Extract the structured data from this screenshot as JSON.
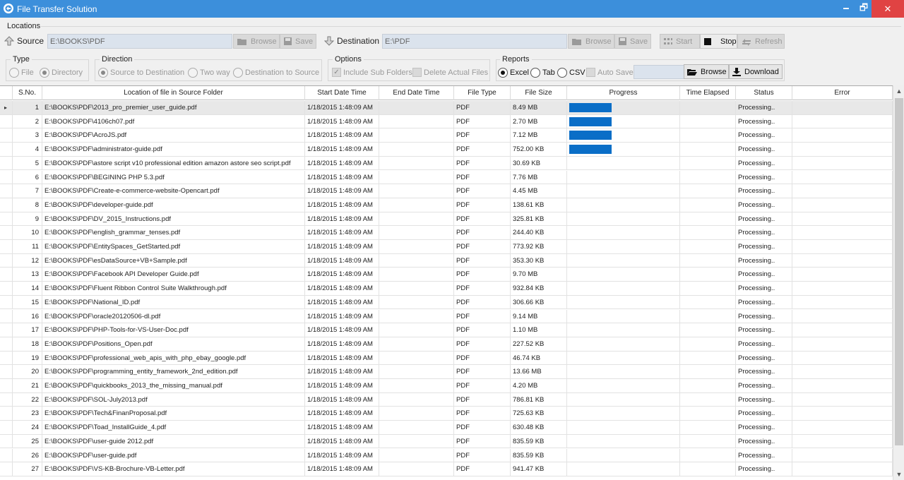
{
  "window": {
    "title": "File Transfer Solution",
    "minimize": "🗕",
    "maximize": "🗗",
    "close": "✕"
  },
  "locations": {
    "label": "Locations",
    "source_label": "Source",
    "source_path": "E:\\BOOKS\\PDF",
    "source_browse": "Browse",
    "source_save": "Save",
    "destination_label": "Destination",
    "destination_path": "E:\\PDF",
    "destination_browse": "Browse",
    "destination_save": "Save",
    "start": "Start",
    "stop": "Stop",
    "refresh": "Refresh"
  },
  "type": {
    "label": "Type",
    "file": "File",
    "directory": "Directory"
  },
  "direction": {
    "label": "Direction",
    "s2d": "Source to Destination",
    "two_way": "Two way",
    "d2s": "Destination to Source"
  },
  "options": {
    "label": "Options",
    "include_sub": "Include Sub Folders",
    "delete_actual": "Delete Actual Files"
  },
  "reports": {
    "label": "Reports",
    "excel": "Excel",
    "tab": "Tab",
    "csv": "CSV",
    "auto_save": "Auto Save",
    "browse": "Browse",
    "download": "Download"
  },
  "columns": [
    "S.No.",
    "Location of file in Source Folder",
    "Start Date Time",
    "End Date Time",
    "File Type",
    "File Size",
    "Progress",
    "Time Elapsed",
    "Status",
    "Error"
  ],
  "rows": [
    {
      "sno": "1",
      "path": "E:\\BOOKS\\PDF\\2013_pro_premier_user_guide.pdf",
      "start": "1/18/2015 1:48:09 AM",
      "end": "",
      "type": "PDF",
      "size": "8.49 MB",
      "progress": 1,
      "elapsed": "",
      "status": "Processing..",
      "error": ""
    },
    {
      "sno": "2",
      "path": "E:\\BOOKS\\PDF\\4106ch07.pdf",
      "start": "1/18/2015 1:48:09 AM",
      "end": "",
      "type": "PDF",
      "size": "2.70 MB",
      "progress": 1,
      "elapsed": "",
      "status": "Processing..",
      "error": ""
    },
    {
      "sno": "3",
      "path": "E:\\BOOKS\\PDF\\AcroJS.pdf",
      "start": "1/18/2015 1:48:09 AM",
      "end": "",
      "type": "PDF",
      "size": "7.12 MB",
      "progress": 1,
      "elapsed": "",
      "status": "Processing..",
      "error": ""
    },
    {
      "sno": "4",
      "path": "E:\\BOOKS\\PDF\\administrator-guide.pdf",
      "start": "1/18/2015 1:48:09 AM",
      "end": "",
      "type": "PDF",
      "size": "752.00 KB",
      "progress": 1,
      "elapsed": "",
      "status": "Processing..",
      "error": ""
    },
    {
      "sno": "5",
      "path": "E:\\BOOKS\\PDF\\astore script v10 professional edition amazon astore seo script.pdf",
      "start": "1/18/2015 1:48:09 AM",
      "end": "",
      "type": "PDF",
      "size": "30.69 KB",
      "progress": 0,
      "elapsed": "",
      "status": "Processing..",
      "error": ""
    },
    {
      "sno": "6",
      "path": "E:\\BOOKS\\PDF\\BEGINING PHP 5.3.pdf",
      "start": "1/18/2015 1:48:09 AM",
      "end": "",
      "type": "PDF",
      "size": "7.76 MB",
      "progress": 0,
      "elapsed": "",
      "status": "Processing..",
      "error": ""
    },
    {
      "sno": "7",
      "path": "E:\\BOOKS\\PDF\\Create-e-commerce-website-Opencart.pdf",
      "start": "1/18/2015 1:48:09 AM",
      "end": "",
      "type": "PDF",
      "size": "4.45 MB",
      "progress": 0,
      "elapsed": "",
      "status": "Processing..",
      "error": ""
    },
    {
      "sno": "8",
      "path": "E:\\BOOKS\\PDF\\developer-guide.pdf",
      "start": "1/18/2015 1:48:09 AM",
      "end": "",
      "type": "PDF",
      "size": "138.61 KB",
      "progress": 0,
      "elapsed": "",
      "status": "Processing..",
      "error": ""
    },
    {
      "sno": "9",
      "path": "E:\\BOOKS\\PDF\\DV_2015_Instructions.pdf",
      "start": "1/18/2015 1:48:09 AM",
      "end": "",
      "type": "PDF",
      "size": "325.81 KB",
      "progress": 0,
      "elapsed": "",
      "status": "Processing..",
      "error": ""
    },
    {
      "sno": "10",
      "path": "E:\\BOOKS\\PDF\\english_grammar_tenses.pdf",
      "start": "1/18/2015 1:48:09 AM",
      "end": "",
      "type": "PDF",
      "size": "244.40 KB",
      "progress": 0,
      "elapsed": "",
      "status": "Processing..",
      "error": ""
    },
    {
      "sno": "11",
      "path": "E:\\BOOKS\\PDF\\EntitySpaces_GetStarted.pdf",
      "start": "1/18/2015 1:48:09 AM",
      "end": "",
      "type": "PDF",
      "size": "773.92 KB",
      "progress": 0,
      "elapsed": "",
      "status": "Processing..",
      "error": ""
    },
    {
      "sno": "12",
      "path": "E:\\BOOKS\\PDF\\esDataSource+VB+Sample.pdf",
      "start": "1/18/2015 1:48:09 AM",
      "end": "",
      "type": "PDF",
      "size": "353.30 KB",
      "progress": 0,
      "elapsed": "",
      "status": "Processing..",
      "error": ""
    },
    {
      "sno": "13",
      "path": "E:\\BOOKS\\PDF\\Facebook API Developer Guide.pdf",
      "start": "1/18/2015 1:48:09 AM",
      "end": "",
      "type": "PDF",
      "size": "9.70 MB",
      "progress": 0,
      "elapsed": "",
      "status": "Processing..",
      "error": ""
    },
    {
      "sno": "14",
      "path": "E:\\BOOKS\\PDF\\Fluent Ribbon Control Suite Walkthrough.pdf",
      "start": "1/18/2015 1:48:09 AM",
      "end": "",
      "type": "PDF",
      "size": "932.84 KB",
      "progress": 0,
      "elapsed": "",
      "status": "Processing..",
      "error": ""
    },
    {
      "sno": "15",
      "path": "E:\\BOOKS\\PDF\\National_ID.pdf",
      "start": "1/18/2015 1:48:09 AM",
      "end": "",
      "type": "PDF",
      "size": "306.66 KB",
      "progress": 0,
      "elapsed": "",
      "status": "Processing..",
      "error": ""
    },
    {
      "sno": "16",
      "path": "E:\\BOOKS\\PDF\\oracle20120506-dl.pdf",
      "start": "1/18/2015 1:48:09 AM",
      "end": "",
      "type": "PDF",
      "size": "9.14 MB",
      "progress": 0,
      "elapsed": "",
      "status": "Processing..",
      "error": ""
    },
    {
      "sno": "17",
      "path": "E:\\BOOKS\\PDF\\PHP-Tools-for-VS-User-Doc.pdf",
      "start": "1/18/2015 1:48:09 AM",
      "end": "",
      "type": "PDF",
      "size": "1.10 MB",
      "progress": 0,
      "elapsed": "",
      "status": "Processing..",
      "error": ""
    },
    {
      "sno": "18",
      "path": "E:\\BOOKS\\PDF\\Positions_Open.pdf",
      "start": "1/18/2015 1:48:09 AM",
      "end": "",
      "type": "PDF",
      "size": "227.52 KB",
      "progress": 0,
      "elapsed": "",
      "status": "Processing..",
      "error": ""
    },
    {
      "sno": "19",
      "path": "E:\\BOOKS\\PDF\\professional_web_apis_with_php_ebay_google.pdf",
      "start": "1/18/2015 1:48:09 AM",
      "end": "",
      "type": "PDF",
      "size": "46.74 KB",
      "progress": 0,
      "elapsed": "",
      "status": "Processing..",
      "error": ""
    },
    {
      "sno": "20",
      "path": "E:\\BOOKS\\PDF\\programming_entity_framework_2nd_edition.pdf",
      "start": "1/18/2015 1:48:09 AM",
      "end": "",
      "type": "PDF",
      "size": "13.66 MB",
      "progress": 0,
      "elapsed": "",
      "status": "Processing..",
      "error": ""
    },
    {
      "sno": "21",
      "path": "E:\\BOOKS\\PDF\\quickbooks_2013_the_missing_manual.pdf",
      "start": "1/18/2015 1:48:09 AM",
      "end": "",
      "type": "PDF",
      "size": "4.20 MB",
      "progress": 0,
      "elapsed": "",
      "status": "Processing..",
      "error": ""
    },
    {
      "sno": "22",
      "path": "E:\\BOOKS\\PDF\\SOL-July2013.pdf",
      "start": "1/18/2015 1:48:09 AM",
      "end": "",
      "type": "PDF",
      "size": "786.81 KB",
      "progress": 0,
      "elapsed": "",
      "status": "Processing..",
      "error": ""
    },
    {
      "sno": "23",
      "path": "E:\\BOOKS\\PDF\\Tech&FinanProposal.pdf",
      "start": "1/18/2015 1:48:09 AM",
      "end": "",
      "type": "PDF",
      "size": "725.63 KB",
      "progress": 0,
      "elapsed": "",
      "status": "Processing..",
      "error": ""
    },
    {
      "sno": "24",
      "path": "E:\\BOOKS\\PDF\\Toad_InstallGuide_4.pdf",
      "start": "1/18/2015 1:48:09 AM",
      "end": "",
      "type": "PDF",
      "size": "630.48 KB",
      "progress": 0,
      "elapsed": "",
      "status": "Processing..",
      "error": ""
    },
    {
      "sno": "25",
      "path": "E:\\BOOKS\\PDF\\user-guide 2012.pdf",
      "start": "1/18/2015 1:48:09 AM",
      "end": "",
      "type": "PDF",
      "size": "835.59 KB",
      "progress": 0,
      "elapsed": "",
      "status": "Processing..",
      "error": ""
    },
    {
      "sno": "26",
      "path": "E:\\BOOKS\\PDF\\user-guide.pdf",
      "start": "1/18/2015 1:48:09 AM",
      "end": "",
      "type": "PDF",
      "size": "835.59 KB",
      "progress": 0,
      "elapsed": "",
      "status": "Processing..",
      "error": ""
    },
    {
      "sno": "27",
      "path": "E:\\BOOKS\\PDF\\VS-KB-Brochure-VB-Letter.pdf",
      "start": "1/18/2015 1:48:09 AM",
      "end": "",
      "type": "PDF",
      "size": "941.47 KB",
      "progress": 0,
      "elapsed": "",
      "status": "Processing..",
      "error": ""
    }
  ],
  "selected_row_marker": "▸",
  "colors": {
    "titlebar": "#3c8fdb",
    "close": "#e04343",
    "progress": "#0a6ec7"
  }
}
